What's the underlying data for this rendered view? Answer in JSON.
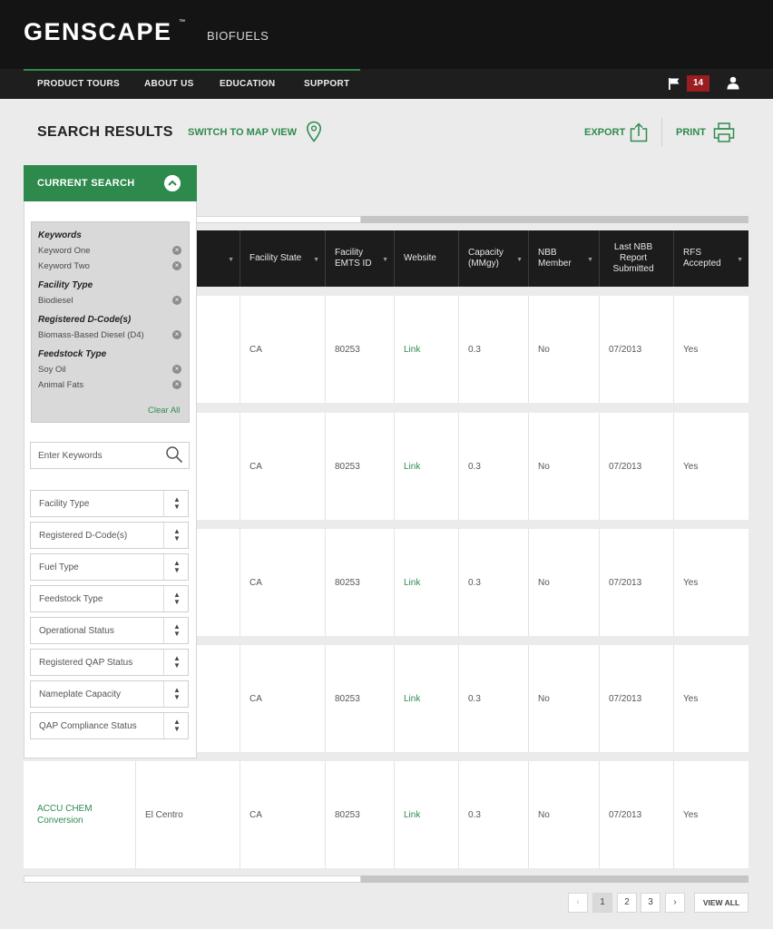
{
  "brand": {
    "name": "GENSCAPE",
    "tm": "™",
    "product": "BIOFUELS"
  },
  "nav": {
    "items": [
      "PRODUCT TOURS",
      "ABOUT US",
      "EDUCATION",
      "SUPPORT"
    ],
    "notifications_count": "14",
    "icons": {
      "flag": "flag-icon",
      "user": "user-icon"
    }
  },
  "page": {
    "title": "SEARCH RESULTS",
    "map_view_label": "SWITCH TO MAP VIEW",
    "export_label": "EXPORT",
    "print_label": "PRINT"
  },
  "sidebar": {
    "header": "CURRENT SEARCH",
    "filter_groups": [
      {
        "label": "Keywords",
        "items": [
          "Keyword One",
          "Keyword Two"
        ]
      },
      {
        "label": "Facility Type",
        "items": [
          "Biodiesel"
        ]
      },
      {
        "label": "Registered D-Code(s)",
        "items": [
          "Biomass-Based Diesel (D4)"
        ]
      },
      {
        "label": "Feedstock Type",
        "items": [
          "Soy Oil",
          "Animal Fats"
        ]
      }
    ],
    "clear_all": "Clear All",
    "keyword_placeholder": "Enter Keywords",
    "selects": [
      "Facility Type",
      "Registered D-Code(s)",
      "Fuel Type",
      "Feedstock Type",
      "Operational Status",
      "Registered QAP Status",
      "Nameplate Capacity",
      "QAP Compliance Status"
    ]
  },
  "table": {
    "columns": [
      "",
      "",
      "Facility State",
      "Facility EMTS ID",
      "Website",
      "Capacity (MMgy)",
      "NBB Member",
      "Last NBB Report Submitted",
      "RFS Accepted"
    ],
    "rows": [
      [
        "",
        "",
        "CA",
        "80253",
        "Link",
        "0.3",
        "No",
        "07/2013",
        "Yes"
      ],
      [
        "",
        "",
        "CA",
        "80253",
        "Link",
        "0.3",
        "No",
        "07/2013",
        "Yes"
      ],
      [
        "",
        "",
        "CA",
        "80253",
        "Link",
        "0.3",
        "No",
        "07/2013",
        "Yes"
      ],
      [
        "",
        "",
        "CA",
        "80253",
        "Link",
        "0.3",
        "No",
        "07/2013",
        "Yes"
      ],
      [
        "ACCU CHEM Conversion",
        "El Centro",
        "CA",
        "80253",
        "Link",
        "0.3",
        "No",
        "07/2013",
        "Yes"
      ]
    ]
  },
  "pagination": {
    "prev": "‹",
    "pages": [
      "1",
      "2",
      "3"
    ],
    "current": "1",
    "next": "›",
    "view_all": "VIEW ALL"
  },
  "colors": {
    "accent": "#2d8a4c",
    "header_bg": "#141414",
    "badge": "#9b1d20",
    "page_bg": "#ebebeb"
  }
}
